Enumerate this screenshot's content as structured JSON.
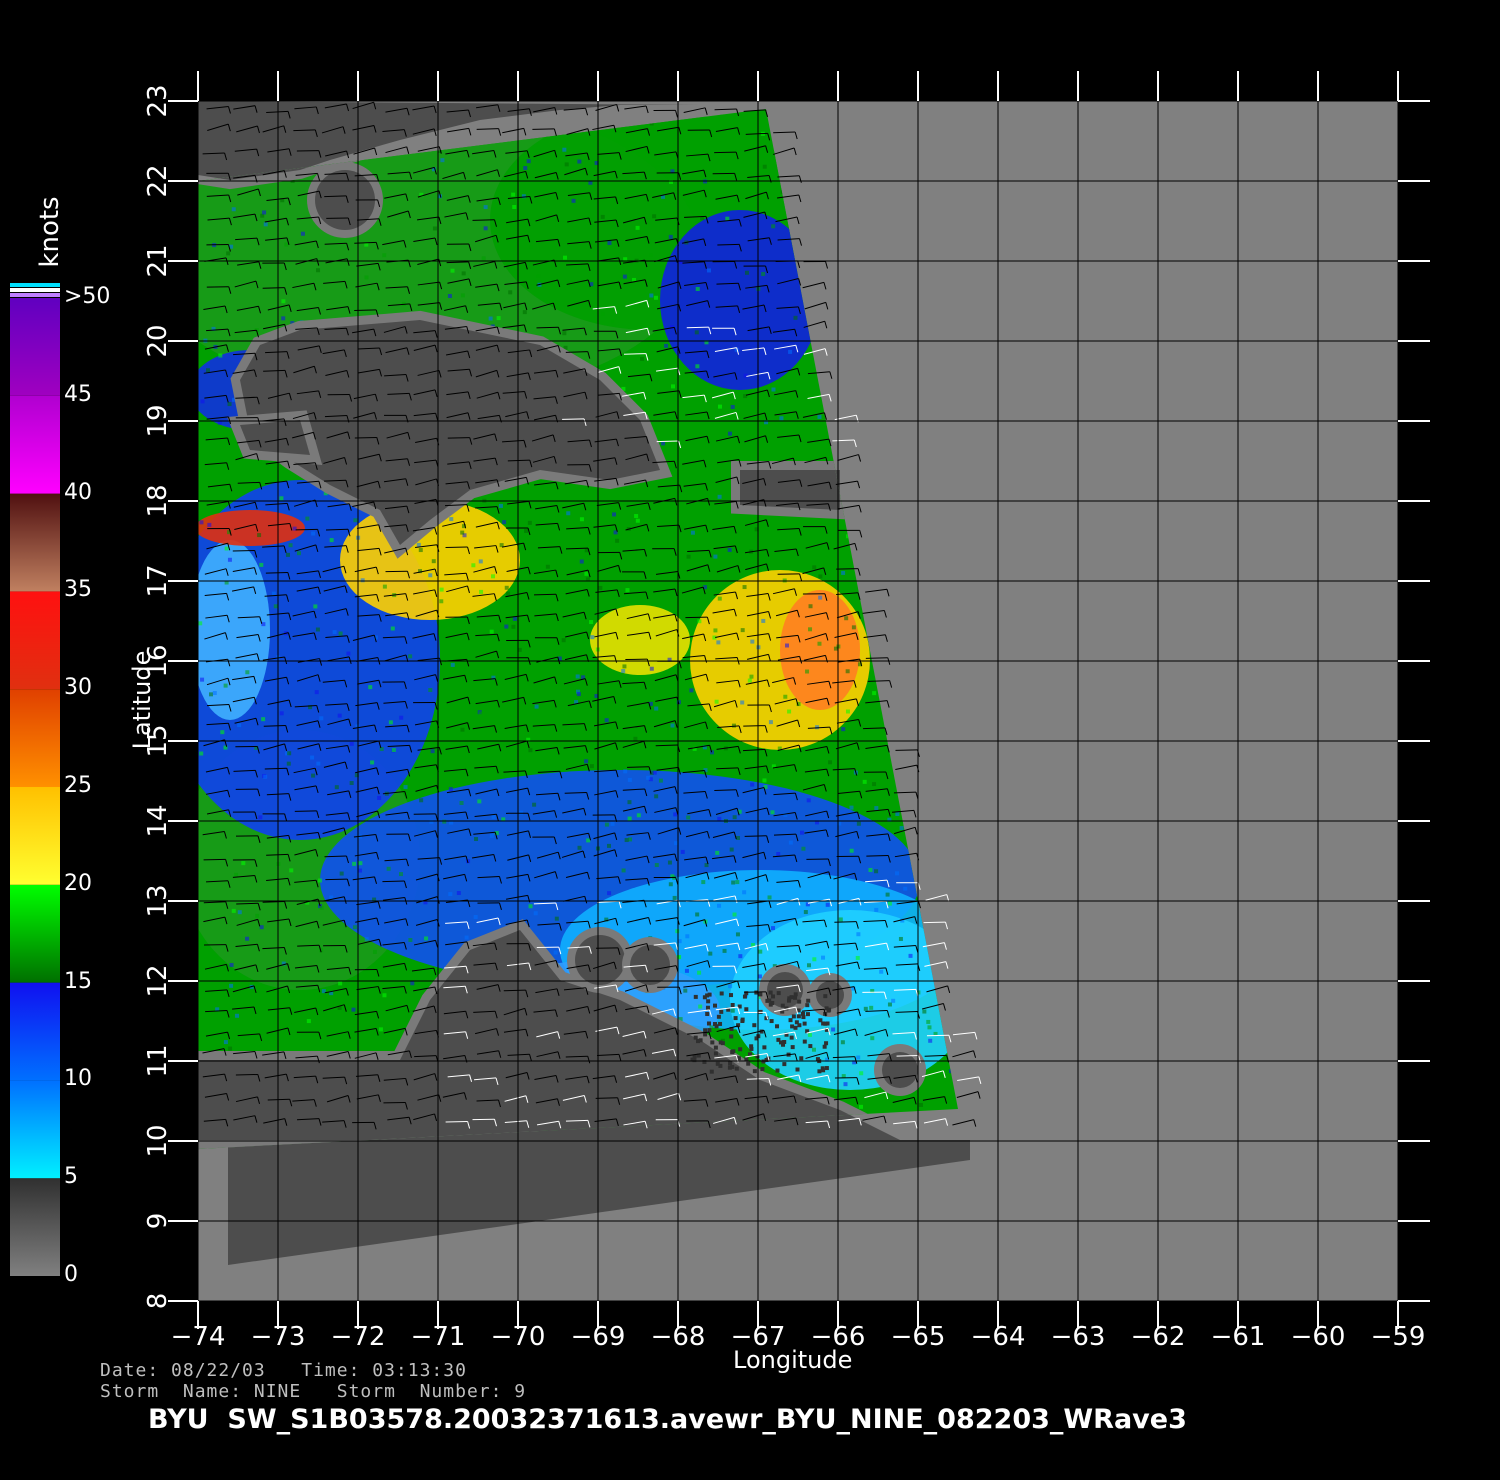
{
  "map": {
    "x_axis_label": "Longitude",
    "y_axis_label": "Latitude",
    "lon_range": [
      -74,
      -59
    ],
    "lat_range": [
      8,
      23
    ],
    "lon_ticks": [
      "-74",
      "-73",
      "-72",
      "-71",
      "-70",
      "-69",
      "-68",
      "-67",
      "-66",
      "-65",
      "-64",
      "-63",
      "-62",
      "-61",
      "-60",
      "-59"
    ],
    "lat_ticks": [
      "8",
      "9",
      "10",
      "11",
      "12",
      "13",
      "14",
      "15",
      "16",
      "17",
      "18",
      "19",
      "20",
      "21",
      "22",
      "23"
    ],
    "grid": true,
    "background_color": "#808080",
    "land_color": "#4d4d4d",
    "swath_corners_lonlat": [
      [
        -74,
        22
      ],
      [
        -66.9,
        22.9
      ],
      [
        -64.5,
        10.4
      ],
      [
        -74,
        9.9
      ]
    ]
  },
  "colorbar": {
    "unit": "knots",
    "labels": [
      "0",
      "5",
      "10",
      "15",
      "20",
      "25",
      "30",
      "35",
      "40",
      "45",
      ">50"
    ],
    "bands": [
      {
        "from": 0,
        "to": 5,
        "colors": [
          "#808080",
          "#303030"
        ]
      },
      {
        "from": 5,
        "to": 10,
        "colors": [
          "#00f0ff",
          "#0070ff"
        ]
      },
      {
        "from": 10,
        "to": 15,
        "colors": [
          "#0070ff",
          "#1010f0"
        ]
      },
      {
        "from": 15,
        "to": 20,
        "colors": [
          "#007000",
          "#00ff00"
        ]
      },
      {
        "from": 20,
        "to": 25,
        "colors": [
          "#ffff30",
          "#ffc000"
        ]
      },
      {
        "from": 25,
        "to": 30,
        "colors": [
          "#ff9000",
          "#e04000"
        ]
      },
      {
        "from": 30,
        "to": 35,
        "colors": [
          "#e03010",
          "#ff1010"
        ]
      },
      {
        "from": 35,
        "to": 40,
        "colors": [
          "#c08060",
          "#501010"
        ]
      },
      {
        "from": 40,
        "to": 45,
        "colors": [
          "#ff00ff",
          "#b000d0"
        ]
      },
      {
        "from": 45,
        "to": 50,
        "colors": [
          "#a000c0",
          "#6000c0"
        ]
      }
    ]
  },
  "info": {
    "line1": "Date: 08/22/03   Time: 03:13:30",
    "line2": "Storm  Name: NINE   Storm  Number: 9",
    "title": "BYU  SW_S1B03578.20032371613.avewr_BYU_NINE_082203_WRave3"
  }
}
